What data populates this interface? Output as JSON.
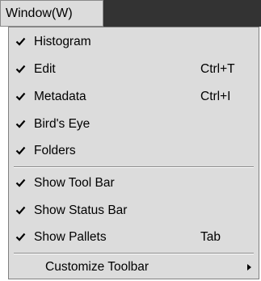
{
  "menubar": {
    "active_menu": "Window(W)"
  },
  "menu": {
    "items": [
      {
        "label": "Histogram",
        "checked": true,
        "shortcut": ""
      },
      {
        "label": "Edit",
        "checked": true,
        "shortcut": "Ctrl+T"
      },
      {
        "label": "Metadata",
        "checked": true,
        "shortcut": "Ctrl+I"
      },
      {
        "label": "Bird's Eye",
        "checked": true,
        "shortcut": ""
      },
      {
        "label": "Folders",
        "checked": true,
        "shortcut": ""
      },
      {
        "label": "Show Tool Bar",
        "checked": true,
        "shortcut": ""
      },
      {
        "label": "Show Status Bar",
        "checked": true,
        "shortcut": ""
      },
      {
        "label": "Show Pallets",
        "checked": true,
        "shortcut": "Tab"
      },
      {
        "label": "Customize Toolbar",
        "checked": false,
        "shortcut": "",
        "submenu": true
      }
    ]
  },
  "colors": {
    "menubar_bg": "#333333",
    "menu_bg": "#dcdcdc"
  }
}
